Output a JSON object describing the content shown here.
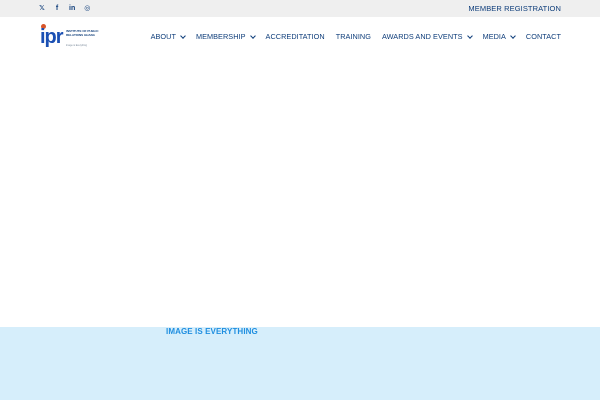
{
  "topbar": {
    "social": [
      {
        "icon": "twitter-icon",
        "glyph": "🐦"
      },
      {
        "icon": "facebook-icon",
        "glyph": "f"
      },
      {
        "icon": "linkedin-icon",
        "glyph": "in"
      },
      {
        "icon": "instagram-icon",
        "glyph": "◎"
      }
    ],
    "member_registration": "MEMBER REGISTRATION"
  },
  "logo": {
    "mark": "ipr",
    "text": "INSTITUTE OF PUBLIC RELATIONS GHANA",
    "subtext": "Image is Everything"
  },
  "nav": {
    "about": "ABOUT",
    "membership": "MEMBERSHIP",
    "accreditation": "ACCREDITATION",
    "training": "TRAINING",
    "awards": "AWARDS AND EVENTS",
    "media": "MEDIA",
    "contact": "CONTACT"
  },
  "band": {
    "tagline": "IMAGE IS EVERYTHING"
  },
  "colors": {
    "brand": "#0e3d7a",
    "accent": "#1e8ee0",
    "band_bg": "#d6eefb",
    "topbar_bg": "#efefef"
  }
}
